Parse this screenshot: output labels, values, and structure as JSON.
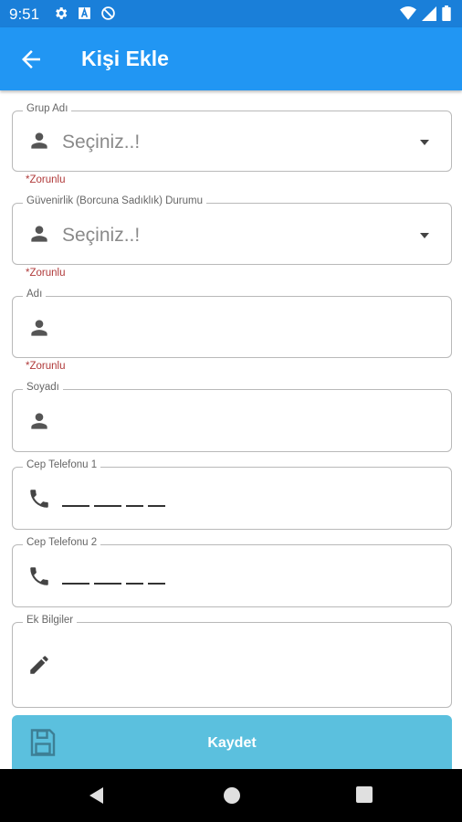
{
  "status_bar": {
    "time": "9:51",
    "left_icons": [
      "settings-icon",
      "a-box-icon",
      "dnd-icon"
    ],
    "right_icons": [
      "wifi-icon",
      "signal-icon",
      "battery-icon"
    ]
  },
  "app_bar": {
    "title": "Kişi Ekle",
    "back_icon": "arrow-left-icon",
    "color": "#2196f3"
  },
  "form": {
    "group": {
      "label": "Grup Adı",
      "placeholder": "Seçiniz..!",
      "required": "*Zorunlu",
      "icon": "person-icon"
    },
    "trust": {
      "label": "Güvenirlik (Borcuna Sadıklık) Durumu",
      "placeholder": "Seçiniz..!",
      "required": "*Zorunlu",
      "icon": "person-icon"
    },
    "first_name": {
      "label": "Adı",
      "value": "",
      "required": "*Zorunlu",
      "icon": "person-icon"
    },
    "last_name": {
      "label": "Soyadı",
      "value": "",
      "icon": "person-icon"
    },
    "phone1": {
      "label": "Cep Telefonu 1",
      "mask": "___ ___ __ __",
      "icon": "phone-icon"
    },
    "phone2": {
      "label": "Cep Telefonu 2",
      "mask": "___ ___ __ __",
      "icon": "phone-icon"
    },
    "extra": {
      "label": "Ek Bilgiler",
      "value": "",
      "icon": "pencil-icon"
    }
  },
  "save_button": {
    "label": "Kaydet",
    "icon": "floppy-disk-icon",
    "color": "#5bc0de"
  },
  "nav_bar": {
    "items": [
      "back-triangle-icon",
      "home-circle-icon",
      "recents-square-icon"
    ]
  },
  "colors": {
    "required": "#b03a3a",
    "border": "#b9b9b9"
  }
}
